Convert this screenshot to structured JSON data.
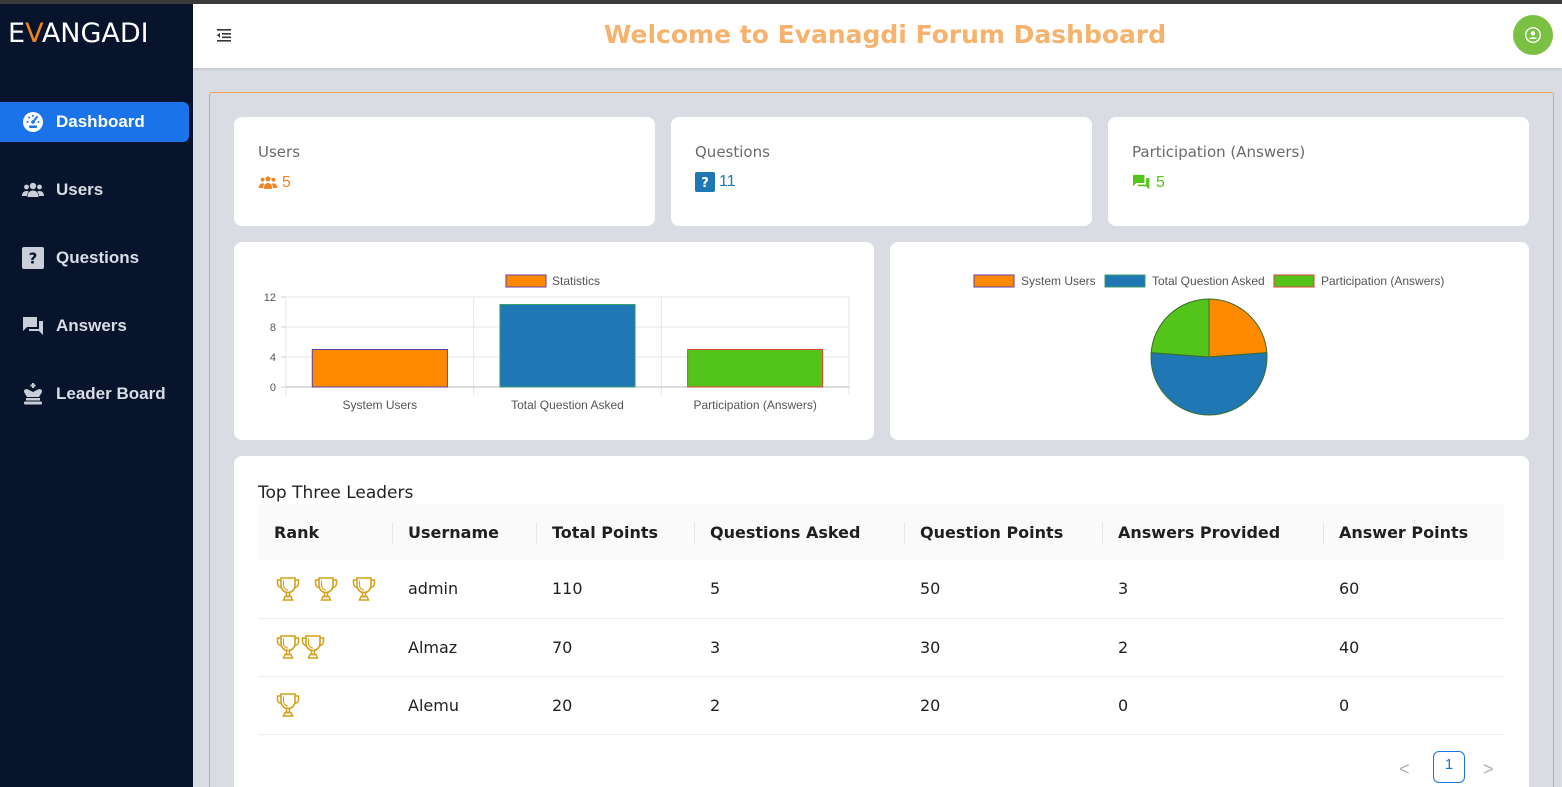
{
  "app": {
    "logo_prefix": "E",
    "logo_accent": "V",
    "logo_suffix": "ANGADI",
    "header_title": "Welcome to Evanagdi Forum Dashboard"
  },
  "sidebar": {
    "items": [
      {
        "label": "Dashboard",
        "icon": "dashboard-gauge-icon",
        "active": true
      },
      {
        "label": "Users",
        "icon": "users-icon"
      },
      {
        "label": "Questions",
        "icon": "question-icon"
      },
      {
        "label": "Answers",
        "icon": "answers-chat-icon"
      },
      {
        "label": "Leader Board",
        "icon": "chess-king-icon"
      }
    ]
  },
  "stats": {
    "users": {
      "label": "Users",
      "value": "5",
      "color": "#f58220"
    },
    "questions": {
      "label": "Questions",
      "value": "11",
      "color": "#1f77b4"
    },
    "participation": {
      "label": "Participation (Answers)",
      "value": "5",
      "color": "#52c41a"
    }
  },
  "colors": {
    "orange": "#ff8a00",
    "blue": "#1f77b4",
    "green": "#52c41a",
    "sidebar_bg": "#07142b",
    "active_blue": "#1a73e8",
    "title": "#f6b36d"
  },
  "chart_data": [
    {
      "type": "bar",
      "legend": [
        "Statistics"
      ],
      "categories": [
        "System Users",
        "Total Question Asked",
        "Participation (Answers)"
      ],
      "series": [
        {
          "name": "Statistics",
          "values": [
            5,
            11,
            5
          ]
        }
      ],
      "colors": [
        "#ff8a00",
        "#1f77b4",
        "#52c41a"
      ],
      "ylim": [
        0,
        12
      ],
      "yticks": [
        0,
        4,
        8,
        12
      ],
      "grid": true,
      "legend_position": "top"
    },
    {
      "type": "pie",
      "labels": [
        "System Users",
        "Total Question Asked",
        "Participation (Answers)"
      ],
      "values": [
        5,
        11,
        5
      ],
      "colors": [
        "#ff8a00",
        "#1f77b4",
        "#52c41a"
      ],
      "legend_position": "top"
    }
  ],
  "leaderboard": {
    "title": "Top Three Leaders",
    "columns": [
      "Rank",
      "Username",
      "Total Points",
      "Questions Asked",
      "Question Points",
      "Answers Provided",
      "Answer Points"
    ],
    "rows": [
      {
        "trophies": 3,
        "username": "admin",
        "total_points": "110",
        "questions_asked": "5",
        "question_points": "50",
        "answers_provided": "3",
        "answer_points": "60"
      },
      {
        "trophies": 2,
        "username": "Almaz",
        "total_points": "70",
        "questions_asked": "3",
        "question_points": "30",
        "answers_provided": "2",
        "answer_points": "40"
      },
      {
        "trophies": 1,
        "username": "Alemu",
        "total_points": "20",
        "questions_asked": "2",
        "question_points": "20",
        "answers_provided": "0",
        "answer_points": "0"
      }
    ]
  },
  "pagination": {
    "current_page": "1",
    "prev": "<",
    "next": ">"
  }
}
